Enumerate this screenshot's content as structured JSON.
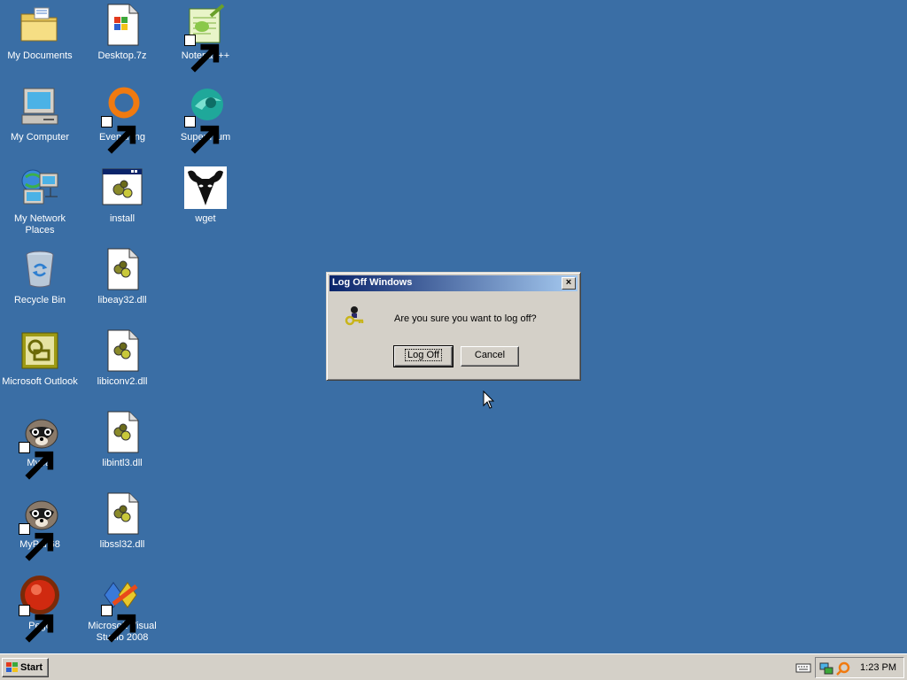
{
  "desktop": {
    "icons": [
      {
        "label": "My Documents"
      },
      {
        "label": "Desktop.7z"
      },
      {
        "label": "Notepad++"
      },
      {
        "label": "My Computer"
      },
      {
        "label": "Everything"
      },
      {
        "label": "Supermium"
      },
      {
        "label": "My Network Places"
      },
      {
        "label": "install"
      },
      {
        "label": "wget"
      },
      {
        "label": "Recycle Bin"
      },
      {
        "label": "libeay32.dll"
      },
      {
        "label": "Microsoft Outlook"
      },
      {
        "label": "libiconv2.dll"
      },
      {
        "label": "Mypal"
      },
      {
        "label": "libintl3.dll"
      },
      {
        "label": "MyPal 68"
      },
      {
        "label": "libssl32.dll"
      },
      {
        "label": "Pego"
      },
      {
        "label": "Microsoft Visual Studio 2008"
      }
    ]
  },
  "dialog": {
    "title": "Log Off Windows",
    "close_label": "×",
    "message": "Are you sure you want to log off?",
    "logoff_label": "Log Off",
    "cancel_label": "Cancel"
  },
  "taskbar": {
    "start_label": "Start",
    "clock": "1:23 PM"
  },
  "colors": {
    "desktop": "#3A6EA5",
    "chrome": "#D4D0C8",
    "title_start": "#0A246A",
    "title_end": "#A6CAF0"
  }
}
